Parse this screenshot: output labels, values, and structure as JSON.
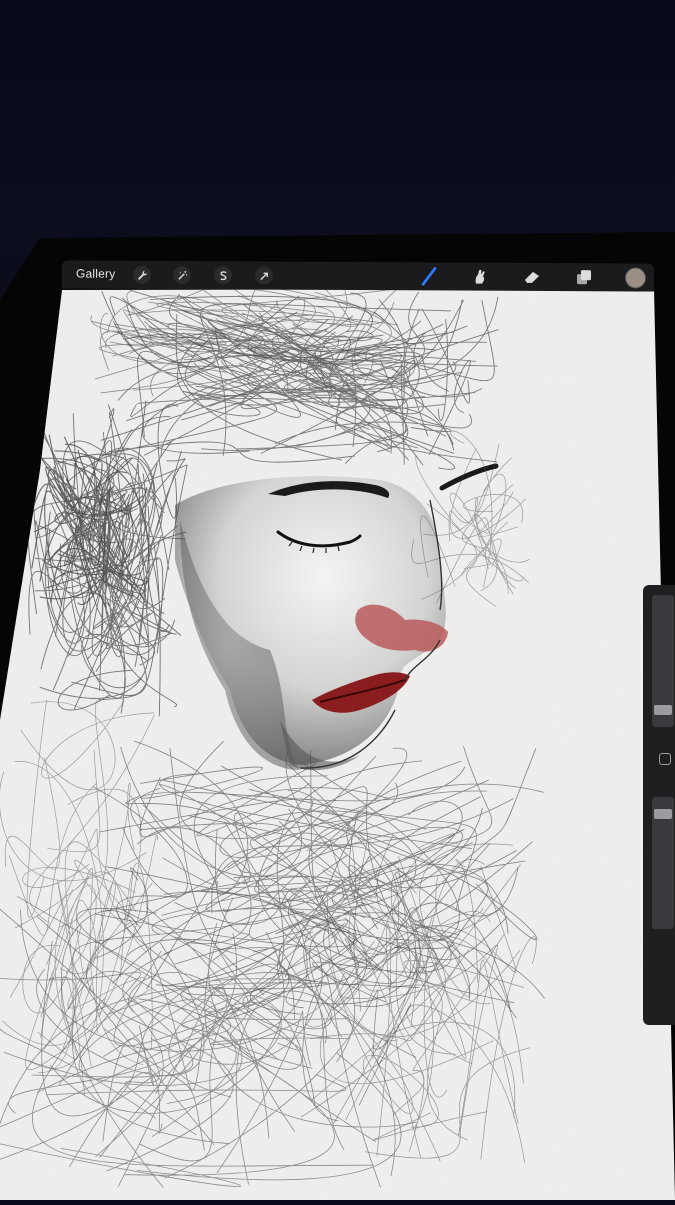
{
  "toolbar": {
    "gallery_label": "Gallery",
    "left_tools": [
      {
        "icon": "wrench-icon",
        "name": "actions"
      },
      {
        "icon": "magic-wand-icon",
        "name": "adjustments"
      },
      {
        "icon": "selection-s-icon",
        "name": "selection"
      },
      {
        "icon": "arrow-cursor-icon",
        "name": "transform"
      }
    ],
    "right_tools": [
      {
        "icon": "brush-icon",
        "name": "paint",
        "active": true,
        "color": "#2f7bff"
      },
      {
        "icon": "smudge-icon",
        "name": "smudge"
      },
      {
        "icon": "eraser-icon",
        "name": "erase"
      },
      {
        "icon": "layers-icon",
        "name": "layers"
      }
    ],
    "current_color": "#9b8f86"
  },
  "sidebar": {
    "brush_size_level": 0.1,
    "opacity_level": 0.9
  },
  "artwork": {
    "description_icon": "sketch-portrait",
    "lip_color": "#8a1d1f",
    "paper_color": "#f1f0ee"
  }
}
